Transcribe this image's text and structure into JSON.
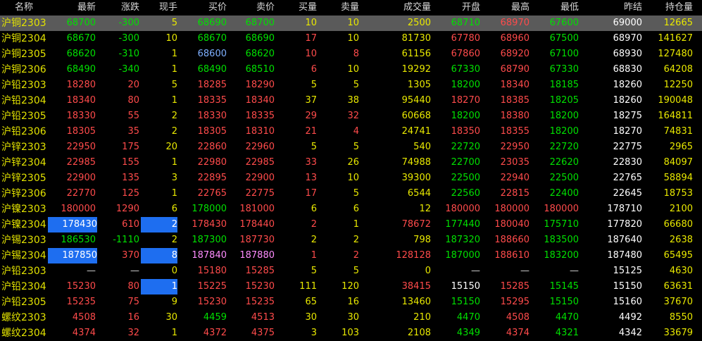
{
  "header": [
    "名称",
    "最新",
    "涨跌",
    "现手",
    "买价",
    "卖价",
    "买量",
    "卖量",
    "成交量",
    "开盘",
    "最高",
    "最低",
    "昨结",
    "持仓量"
  ],
  "rows": [
    {
      "n": "沪铜2303",
      "v": [
        "68700",
        "-300",
        "5",
        "68690",
        "68700",
        "10",
        "10",
        "2500",
        "68710",
        "68970",
        "67600",
        "69000",
        "12665"
      ],
      "col": [
        "green",
        "green",
        "yellow",
        "green",
        "green",
        "yellow",
        "yellow",
        "yellow",
        "green",
        "red",
        "green",
        "white",
        "yellow"
      ],
      "sel": true
    },
    {
      "n": "沪铜2304",
      "v": [
        "68670",
        "-300",
        "10",
        "68670",
        "68690",
        "17",
        "10",
        "81730",
        "67780",
        "68960",
        "67500",
        "68970",
        "141627"
      ],
      "col": [
        "green",
        "green",
        "yellow",
        "green",
        "green",
        "red",
        "yellow",
        "yellow",
        "red",
        "red",
        "green",
        "white",
        "yellow"
      ]
    },
    {
      "n": "沪铜2305",
      "v": [
        "68620",
        "-310",
        "1",
        "68600",
        "68620",
        "10",
        "8",
        "61156",
        "67860",
        "68920",
        "67100",
        "68930",
        "127480"
      ],
      "col": [
        "green",
        "green",
        "yellow",
        "blue",
        "green",
        "red",
        "red",
        "yellow",
        "red",
        "red",
        "green",
        "white",
        "yellow"
      ]
    },
    {
      "n": "沪铜2306",
      "v": [
        "68490",
        "-340",
        "1",
        "68490",
        "68510",
        "6",
        "10",
        "19292",
        "67330",
        "68790",
        "67330",
        "68830",
        "64208"
      ],
      "col": [
        "green",
        "green",
        "yellow",
        "green",
        "green",
        "red",
        "yellow",
        "yellow",
        "green",
        "red",
        "green",
        "white",
        "yellow"
      ]
    },
    {
      "n": "沪铅2303",
      "v": [
        "18280",
        "20",
        "5",
        "18285",
        "18290",
        "5",
        "5",
        "1305",
        "18200",
        "18340",
        "18185",
        "18260",
        "12250"
      ],
      "col": [
        "red",
        "red",
        "yellow",
        "red",
        "red",
        "yellow",
        "yellow",
        "yellow",
        "green",
        "red",
        "green",
        "white",
        "yellow"
      ]
    },
    {
      "n": "沪铅2304",
      "v": [
        "18340",
        "80",
        "1",
        "18335",
        "18340",
        "37",
        "38",
        "95440",
        "18270",
        "18385",
        "18205",
        "18260",
        "190048"
      ],
      "col": [
        "red",
        "red",
        "yellow",
        "red",
        "red",
        "yellow",
        "yellow",
        "yellow",
        "red",
        "red",
        "green",
        "white",
        "yellow"
      ]
    },
    {
      "n": "沪铅2305",
      "v": [
        "18330",
        "55",
        "2",
        "18330",
        "18335",
        "29",
        "32",
        "60668",
        "18200",
        "18380",
        "18200",
        "18275",
        "164811"
      ],
      "col": [
        "red",
        "red",
        "yellow",
        "red",
        "red",
        "red",
        "red",
        "yellow",
        "green",
        "red",
        "green",
        "white",
        "yellow"
      ]
    },
    {
      "n": "沪铅2306",
      "v": [
        "18305",
        "35",
        "2",
        "18305",
        "18310",
        "21",
        "4",
        "24741",
        "18350",
        "18355",
        "18200",
        "18270",
        "74831"
      ],
      "col": [
        "red",
        "red",
        "yellow",
        "red",
        "red",
        "red",
        "red",
        "yellow",
        "red",
        "red",
        "green",
        "white",
        "yellow"
      ]
    },
    {
      "n": "沪锌2303",
      "v": [
        "22950",
        "175",
        "20",
        "22860",
        "22960",
        "5",
        "5",
        "540",
        "22720",
        "22950",
        "22720",
        "22775",
        "2965"
      ],
      "col": [
        "red",
        "red",
        "yellow",
        "red",
        "red",
        "yellow",
        "yellow",
        "yellow",
        "green",
        "red",
        "green",
        "white",
        "yellow"
      ]
    },
    {
      "n": "沪锌2304",
      "v": [
        "22985",
        "155",
        "1",
        "22980",
        "22985",
        "33",
        "26",
        "74988",
        "22700",
        "23035",
        "22620",
        "22830",
        "84097"
      ],
      "col": [
        "red",
        "red",
        "yellow",
        "red",
        "red",
        "red",
        "yellow",
        "yellow",
        "green",
        "red",
        "green",
        "white",
        "yellow"
      ]
    },
    {
      "n": "沪锌2305",
      "v": [
        "22900",
        "135",
        "3",
        "22895",
        "22900",
        "13",
        "10",
        "39300",
        "22500",
        "22940",
        "22500",
        "22765",
        "58894"
      ],
      "col": [
        "red",
        "red",
        "yellow",
        "red",
        "red",
        "red",
        "yellow",
        "yellow",
        "green",
        "red",
        "green",
        "white",
        "yellow"
      ]
    },
    {
      "n": "沪锌2306",
      "v": [
        "22770",
        "125",
        "1",
        "22765",
        "22775",
        "17",
        "5",
        "6544",
        "22560",
        "22815",
        "22400",
        "22645",
        "18753"
      ],
      "col": [
        "red",
        "red",
        "yellow",
        "red",
        "red",
        "red",
        "yellow",
        "yellow",
        "green",
        "red",
        "green",
        "white",
        "yellow"
      ]
    },
    {
      "n": "沪镍2303",
      "v": [
        "180000",
        "1290",
        "6",
        "178000",
        "181000",
        "6",
        "6",
        "12",
        "180000",
        "180000",
        "180000",
        "178710",
        "2100"
      ],
      "col": [
        "red",
        "red",
        "yellow",
        "green",
        "red",
        "yellow",
        "yellow",
        "yellow",
        "red",
        "red",
        "red",
        "white",
        "yellow"
      ]
    },
    {
      "n": "沪镍2304",
      "v": [
        "178430",
        "610",
        "2",
        "178430",
        "178440",
        "2",
        "1",
        "78672",
        "177440",
        "180040",
        "175710",
        "177820",
        "66680"
      ],
      "col": [
        "white",
        "red",
        "white",
        "red",
        "red",
        "red",
        "yellow",
        "red",
        "green",
        "red",
        "green",
        "white",
        "yellow"
      ],
      "hi": [
        0,
        2
      ]
    },
    {
      "n": "沪锡2303",
      "v": [
        "186530",
        "-1110",
        "2",
        "187300",
        "187730",
        "2",
        "2",
        "798",
        "187320",
        "188660",
        "183500",
        "187640",
        "2638"
      ],
      "col": [
        "green",
        "green",
        "yellow",
        "green",
        "red",
        "yellow",
        "yellow",
        "yellow",
        "green",
        "red",
        "green",
        "white",
        "yellow"
      ]
    },
    {
      "n": "沪锡2304",
      "v": [
        "187850",
        "370",
        "8",
        "187840",
        "187880",
        "1",
        "2",
        "128128",
        "187000",
        "188610",
        "183200",
        "187480",
        "65495"
      ],
      "col": [
        "white",
        "red",
        "white",
        "pink",
        "pink",
        "red",
        "red",
        "red",
        "green",
        "red",
        "green",
        "white",
        "yellow"
      ],
      "hi": [
        0,
        2
      ]
    },
    {
      "n": "沪铅2303",
      "v": [
        "—",
        "—",
        "0",
        "15180",
        "15285",
        "5",
        "5",
        "0",
        "—",
        "—",
        "—",
        "15125",
        "4630"
      ],
      "col": [
        "gray",
        "gray",
        "yellow",
        "red",
        "red",
        "yellow",
        "yellow",
        "yellow",
        "gray",
        "gray",
        "gray",
        "white",
        "yellow"
      ]
    },
    {
      "n": "沪铅2304",
      "v": [
        "15230",
        "80",
        "1",
        "15225",
        "15230",
        "111",
        "120",
        "38415",
        "15150",
        "15285",
        "15145",
        "15150",
        "63631"
      ],
      "col": [
        "red",
        "red",
        "white",
        "red",
        "red",
        "yellow",
        "yellow",
        "red",
        "white",
        "red",
        "green",
        "white",
        "yellow"
      ],
      "hi": [
        2
      ]
    },
    {
      "n": "沪铅2305",
      "v": [
        "15235",
        "75",
        "9",
        "15230",
        "15235",
        "65",
        "16",
        "13460",
        "15150",
        "15295",
        "15150",
        "15160",
        "37670"
      ],
      "col": [
        "red",
        "red",
        "yellow",
        "red",
        "red",
        "yellow",
        "yellow",
        "yellow",
        "green",
        "red",
        "green",
        "white",
        "yellow"
      ]
    },
    {
      "n": "螺纹2303",
      "v": [
        "4508",
        "16",
        "30",
        "4459",
        "4513",
        "30",
        "30",
        "210",
        "4470",
        "4508",
        "4470",
        "4492",
        "8550"
      ],
      "col": [
        "red",
        "red",
        "yellow",
        "green",
        "red",
        "yellow",
        "yellow",
        "yellow",
        "green",
        "red",
        "green",
        "white",
        "yellow"
      ]
    },
    {
      "n": "螺纹2304",
      "v": [
        "4374",
        "32",
        "1",
        "4372",
        "4375",
        "3",
        "103",
        "2108",
        "4349",
        "4374",
        "4321",
        "4342",
        "33679"
      ],
      "col": [
        "red",
        "red",
        "yellow",
        "red",
        "red",
        "yellow",
        "yellow",
        "yellow",
        "green",
        "red",
        "green",
        "white",
        "yellow"
      ]
    }
  ]
}
